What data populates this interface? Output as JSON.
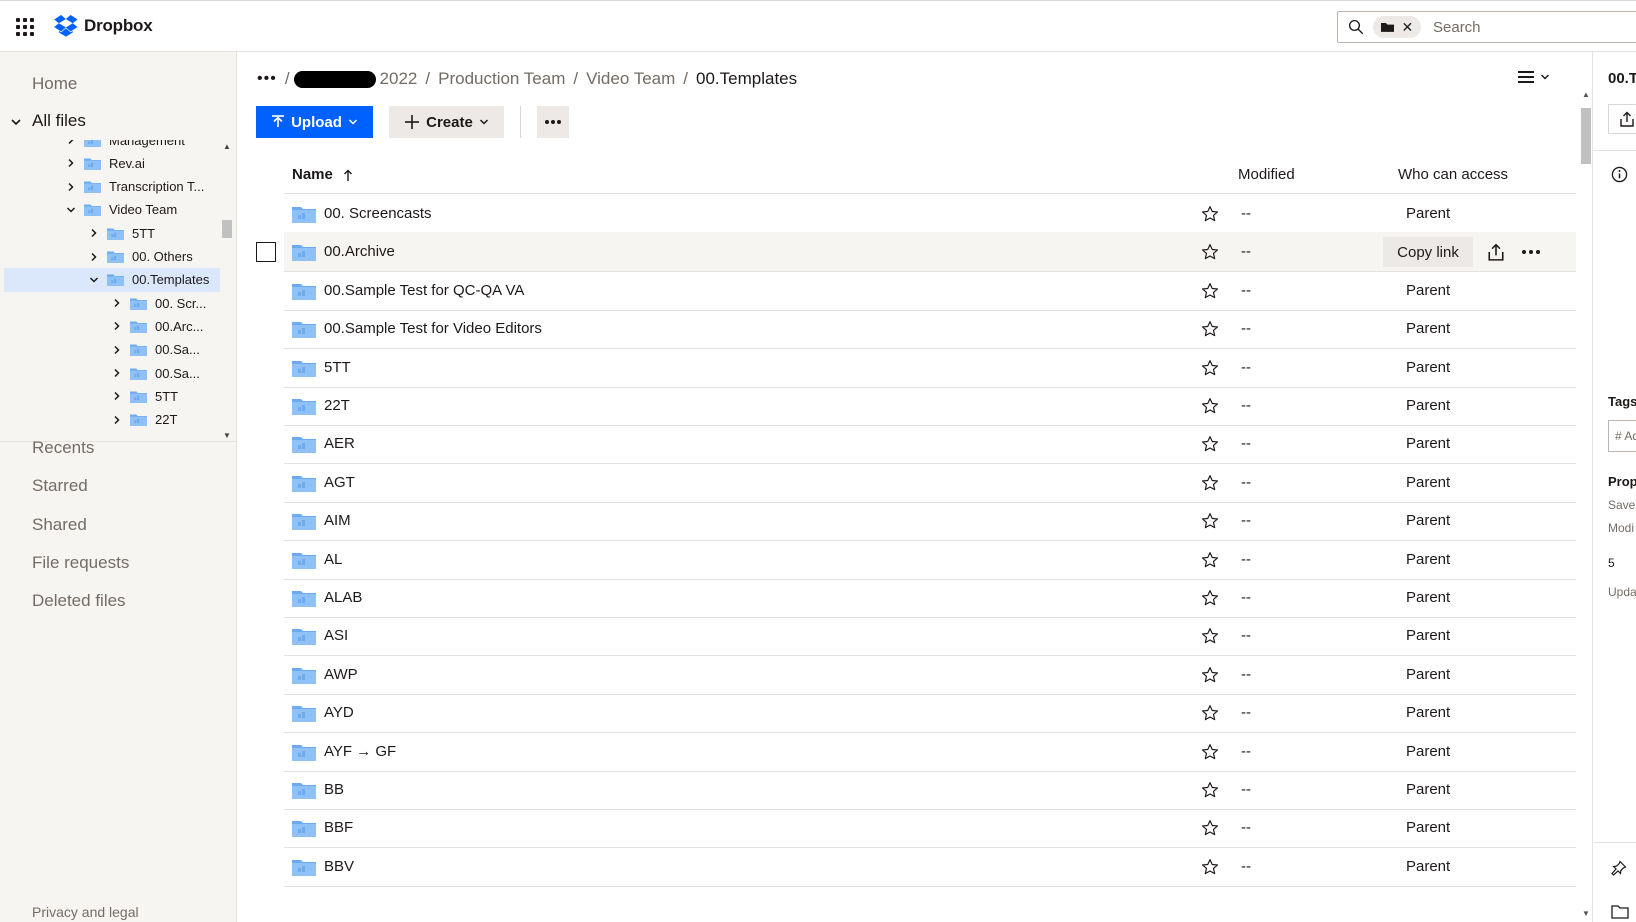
{
  "app": {
    "name": "Dropbox"
  },
  "search": {
    "placeholder": "Search"
  },
  "sidebar": {
    "home": "Home",
    "all_files": "All files",
    "tree": [
      {
        "label": "Management",
        "level": 1,
        "expanded": false
      },
      {
        "label": "Rev.ai",
        "level": 1,
        "expanded": false
      },
      {
        "label": "Transcription T...",
        "level": 1,
        "expanded": false
      },
      {
        "label": "Video Team",
        "level": 1,
        "expanded": true
      },
      {
        "label": "5TT",
        "level": 2,
        "expanded": false
      },
      {
        "label": "00. Others",
        "level": 2,
        "expanded": false
      },
      {
        "label": "00.Templates",
        "level": 2,
        "expanded": true,
        "selected": true
      },
      {
        "label": "00. Scr...",
        "level": 3,
        "expanded": false
      },
      {
        "label": "00.Arc...",
        "level": 3,
        "expanded": false
      },
      {
        "label": "00.Sa...",
        "level": 3,
        "expanded": false
      },
      {
        "label": "00.Sa...",
        "level": 3,
        "expanded": false
      },
      {
        "label": "5TT",
        "level": 3,
        "expanded": false
      },
      {
        "label": "22T",
        "level": 3,
        "expanded": false
      }
    ],
    "recents": "Recents",
    "starred": "Starred",
    "shared": "Shared",
    "file_requests": "File requests",
    "deleted_files": "Deleted files",
    "privacy": "Privacy and legal"
  },
  "breadcrumb": {
    "ellipsis": "•••",
    "lead_sep": "/",
    "year": "2022",
    "sep": "/",
    "items": [
      "Production Team",
      "Video Team"
    ],
    "current": "00.Templates"
  },
  "toolbar": {
    "upload_label": "Upload",
    "create_label": "Create"
  },
  "table": {
    "columns": {
      "name": "Name",
      "modified": "Modified",
      "access": "Who can access"
    },
    "copy_link_label": "Copy link",
    "rows": [
      {
        "name": "00. Screencasts",
        "modified": "--",
        "access": "Parent"
      },
      {
        "name": "00.Archive",
        "modified": "--",
        "access": "Parent",
        "hover": true
      },
      {
        "name": "00.Sample Test for QC-QA VA",
        "modified": "--",
        "access": "Parent"
      },
      {
        "name": "00.Sample Test for Video Editors",
        "modified": "--",
        "access": "Parent"
      },
      {
        "name": "5TT",
        "modified": "--",
        "access": "Parent"
      },
      {
        "name": "22T",
        "modified": "--",
        "access": "Parent"
      },
      {
        "name": "AER",
        "modified": "--",
        "access": "Parent"
      },
      {
        "name": "AGT",
        "modified": "--",
        "access": "Parent"
      },
      {
        "name": "AIM",
        "modified": "--",
        "access": "Parent"
      },
      {
        "name": "AL",
        "modified": "--",
        "access": "Parent"
      },
      {
        "name": "ALAB",
        "modified": "--",
        "access": "Parent"
      },
      {
        "name": "ASI",
        "modified": "--",
        "access": "Parent"
      },
      {
        "name": "AWP",
        "modified": "--",
        "access": "Parent"
      },
      {
        "name": "AYD",
        "modified": "--",
        "access": "Parent"
      },
      {
        "name": "AYF → GF",
        "modified": "--",
        "access": "Parent"
      },
      {
        "name": "BB",
        "modified": "--",
        "access": "Parent"
      },
      {
        "name": "BBF",
        "modified": "--",
        "access": "Parent"
      },
      {
        "name": "BBV",
        "modified": "--",
        "access": "Parent"
      }
    ]
  },
  "info_panel": {
    "title": "00.T",
    "tags_label": "Tags",
    "tag_placeholder": "# Ad",
    "properties_label": "Prop",
    "saved_label": "Save",
    "modified_label": "Modi",
    "count": "5",
    "updated_label": "Upda"
  },
  "colors": {
    "accent": "#0061fe",
    "folder": "#6aabf2",
    "sidebar_bg": "#f7f5f2",
    "selected_bg": "#dbe7fb",
    "button_bg": "#ece9e6"
  }
}
